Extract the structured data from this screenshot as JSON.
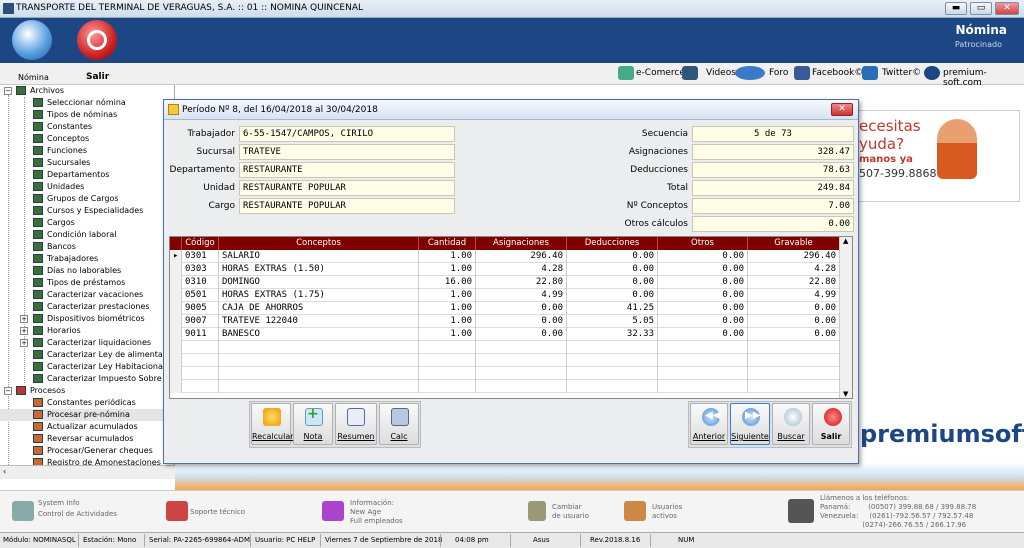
{
  "window": {
    "title": "TRANSPORTE DEL TERMINAL DE VERAGUAS, S.A. :: 01 :: NOMINA QUINCENAL",
    "btn_min": "▬",
    "btn_max": "▭",
    "btn_close": "✕"
  },
  "header": {
    "module": "Nómina",
    "sponsor": "Patrocinado",
    "btn_nomina": "Nómina",
    "btn_salir": "Salir"
  },
  "links": {
    "ecommerce": "e-Comerce",
    "videos": "Videos",
    "foro": "Foro",
    "facebook": "Facebook©",
    "twitter": "Twitter©",
    "site": "premium-soft.com"
  },
  "tree": {
    "archivos": "Archivos",
    "items": [
      "Seleccionar nómina",
      "Tipos de nóminas",
      "Constantes",
      "Conceptos",
      "Funciones",
      "Sucursales",
      "Departamentos",
      "Unidades",
      "Grupos de Cargos",
      "Cursos y Especialidades",
      "Cargos",
      "Condición laboral",
      "Bancos",
      "Trabajadores",
      "Días no laborables",
      "Tipos de préstamos",
      "Caracterizar vacaciones",
      "Caracterizar prestaciones",
      "Dispositivos biométricos",
      "Horarios",
      "Caracterizar liquidaciones",
      "Caracterizar Ley de alimentación",
      "Caracterizar Ley Habitacional (F",
      "Caracterizar Impuesto Sobre la R"
    ],
    "procesos": "Procesos",
    "proc_items": [
      "Constantes periódicas",
      "Procesar pre-nómina",
      "Actualizar acumulados",
      "Reversar acumulados",
      "Procesar/Generar cheques",
      "Registro de Amonestaciones",
      "Registro de Suspensiones"
    ]
  },
  "dialog": {
    "title": "Período Nº 8, del 16/04/2018 al 30/04/2018",
    "close": "✕",
    "labels": {
      "trabajador": "Trabajador",
      "sucursal": "Sucursal",
      "departamento": "Departamento",
      "unidad": "Unidad",
      "cargo": "Cargo",
      "secuencia": "Secuencia",
      "asignaciones": "Asignaciones",
      "deducciones": "Deducciones",
      "total": "Total",
      "nconceptos": "Nº Conceptos",
      "otros": "Otros cálculos"
    },
    "values": {
      "trabajador": "6-55-1547/CAMPOS, CIRILO",
      "sucursal": "TRATEVE",
      "departamento": "RESTAURANTE",
      "unidad": "RESTAURANTE POPULAR",
      "cargo": "RESTAURANTE POPULAR",
      "secuencia": "5 de 73",
      "asignaciones": "328.47",
      "deducciones": "78.63",
      "total": "249.84",
      "nconceptos": "7.00",
      "otros": "0.00"
    },
    "columns": [
      "Código",
      "Conceptos",
      "Cantidad",
      "Asignaciones",
      "Deducciones",
      "Otros",
      "Gravable"
    ],
    "rows": [
      [
        "0301",
        "SALARIO",
        "1.00",
        "296.40",
        "0.00",
        "0.00",
        "296.40"
      ],
      [
        "0303",
        "HORAS EXTRAS (1.50)",
        "1.00",
        "4.28",
        "0.00",
        "0.00",
        "4.28"
      ],
      [
        "0310",
        "DOMINGO",
        "16.00",
        "22.80",
        "0.00",
        "0.00",
        "22.80"
      ],
      [
        "0501",
        "HORAS EXTRAS (1.75)",
        "1.00",
        "4.99",
        "0.00",
        "0.00",
        "4.99"
      ],
      [
        "9005",
        "CAJA DE AHORROS",
        "1.00",
        "0.00",
        "41.25",
        "0.00",
        "0.00"
      ],
      [
        "9007",
        "TRATEVE 122040",
        "1.00",
        "0.00",
        "5.05",
        "0.00",
        "0.00"
      ],
      [
        "9011",
        "BANESCO",
        "1.00",
        "0.00",
        "32.33",
        "0.00",
        "0.00"
      ]
    ],
    "buttons": {
      "recalcular": "Recalcular",
      "nota": "Nota",
      "resumen": "Resumen",
      "calc": "Calc",
      "anterior": "Anterior",
      "siguiente": "Siguiente",
      "buscar": "Buscar",
      "salir": "Salir"
    }
  },
  "ad": {
    "l1": "ecesitas",
    "l2": "yuda?",
    "l3": "manos ya",
    "l4": "507-399.8868"
  },
  "brand": "premiumsoft",
  "bottom": {
    "sysinfo": "System Info",
    "control": "Control de Actividades",
    "soporte": "Soporte técnico",
    "info": "Información:",
    "newage": "New Age",
    "full": "Full empleados",
    "cambiar": "Cambiar",
    "deusuario": "de usuario",
    "usuarios": "Usuarios",
    "activos": "activos",
    "llamenos": "Llámenos a los teléfonos:",
    "panama": "Panamá:        (00507) 399.88.68 / 399.88.78",
    "venezuela": "Venezuela:     (0261)-792.56.57 / 792.57.48",
    "venezuela2": "                   (0274)-266.76.55 / 266.17.96"
  },
  "status": {
    "modulo": "Módulo: NOMINASQL",
    "estacion": "Estación: Mono",
    "serial": "Serial: PA-2265-699864-ADM",
    "usuario": "Usuario: PC HELP",
    "fecha": "Viernes 7 de Septiembre de 2018",
    "hora": "04:08 pm",
    "asus": "Asus",
    "rev": "Rev.2018.8.16",
    "num": "NUM"
  }
}
